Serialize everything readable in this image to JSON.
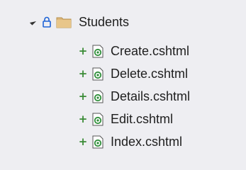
{
  "tree": {
    "folder": {
      "label": "Students",
      "icon": "folder-icon",
      "lock_icon": "lock-icon",
      "expanded": true
    },
    "files": [
      {
        "label": "Create.cshtml",
        "status": "+",
        "icon": "razor-file-icon"
      },
      {
        "label": "Delete.cshtml",
        "status": "+",
        "icon": "razor-file-icon"
      },
      {
        "label": "Details.cshtml",
        "status": "+",
        "icon": "razor-file-icon"
      },
      {
        "label": "Edit.cshtml",
        "status": "+",
        "icon": "razor-file-icon"
      },
      {
        "label": "Index.cshtml",
        "status": "+",
        "icon": "razor-file-icon"
      }
    ]
  },
  "colors": {
    "background": "#eeeef2",
    "folder": "#dcb67a",
    "lock": "#1e63d6",
    "added": "#388a34",
    "razor_icon": "#2f8f3a"
  }
}
